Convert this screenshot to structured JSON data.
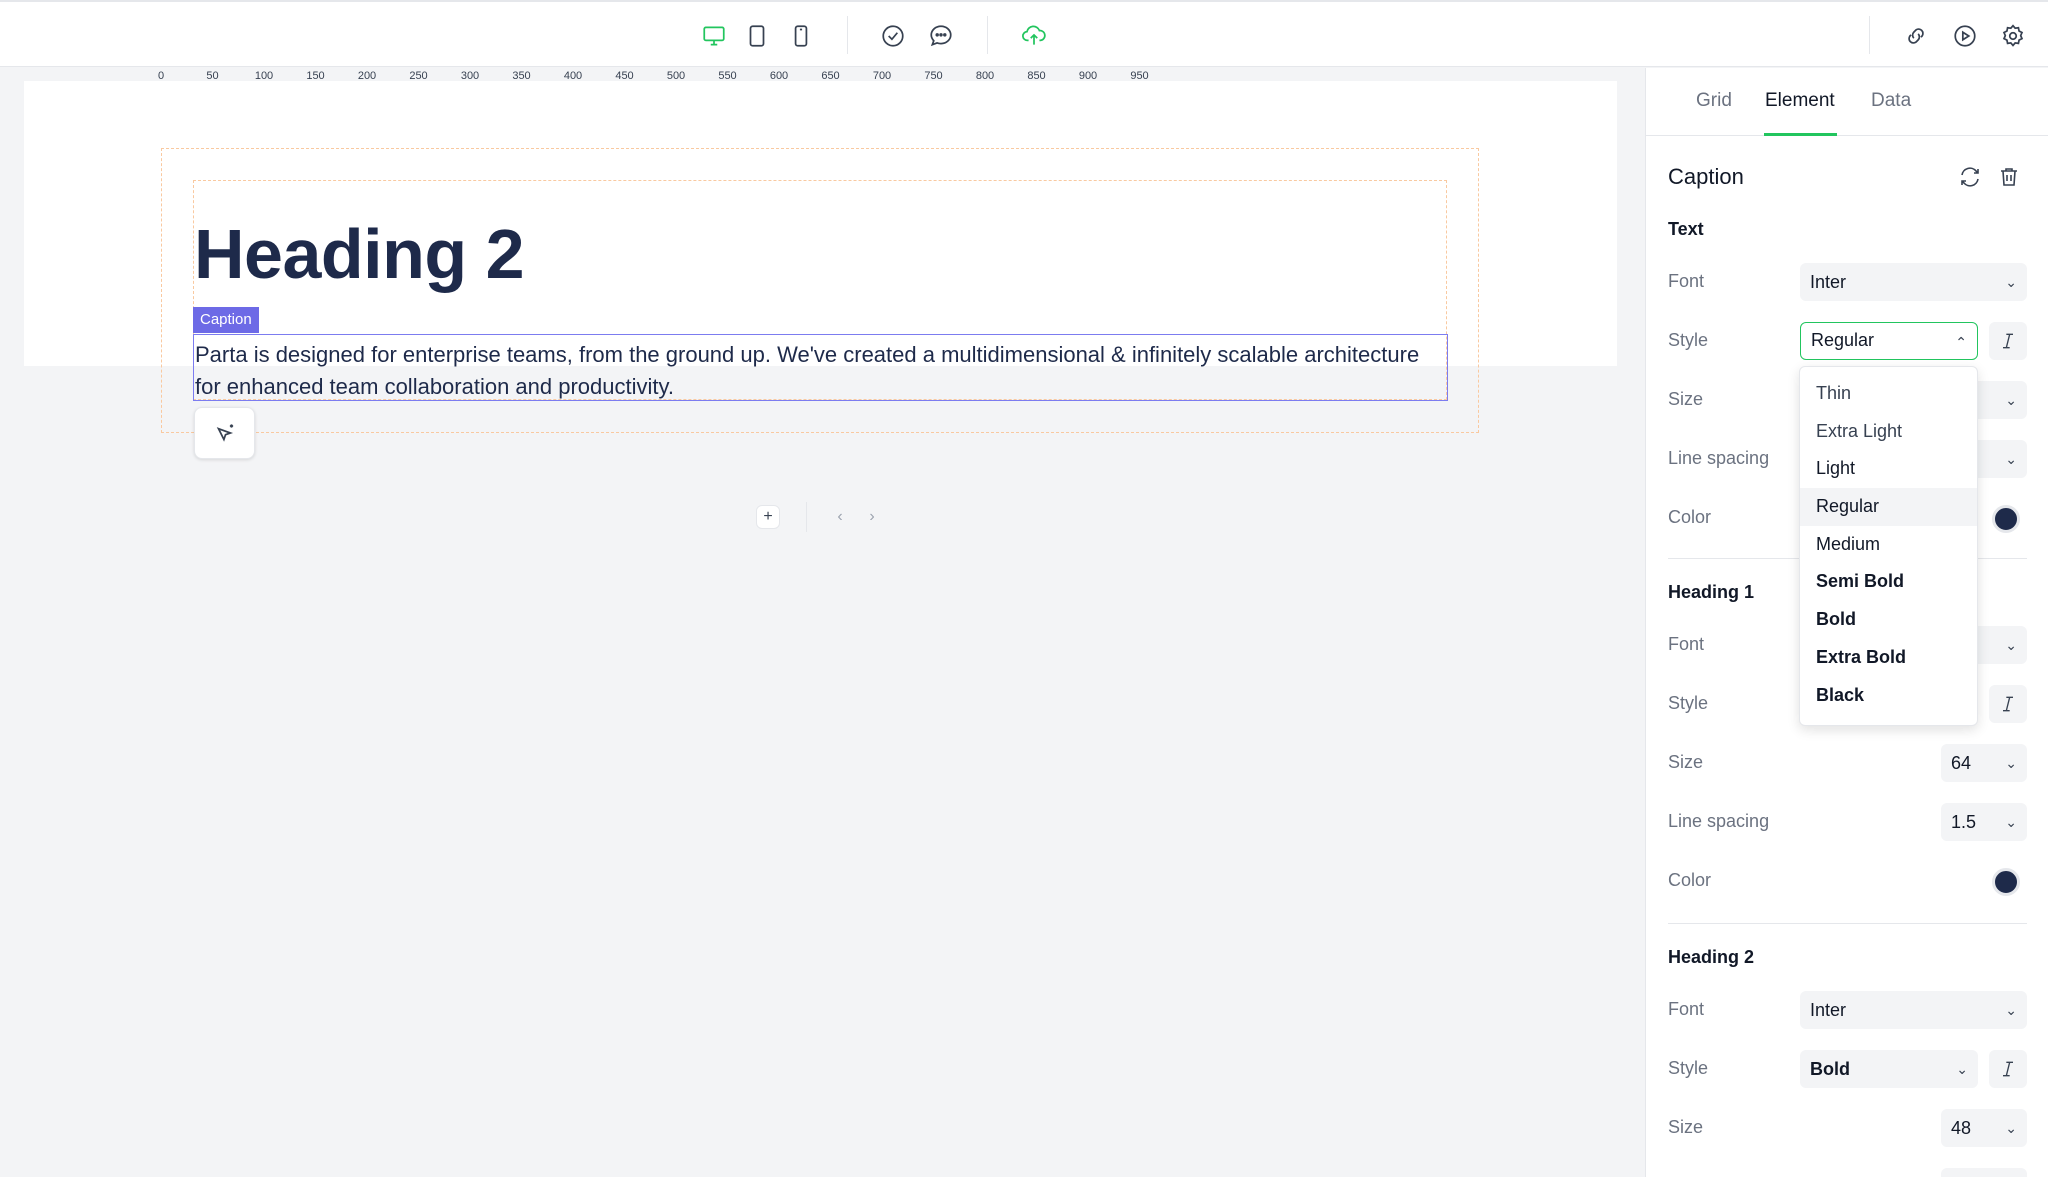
{
  "toolbar": {
    "device_icons": [
      "desktop-icon",
      "tablet-icon",
      "mobile-icon"
    ],
    "action_icons": [
      "check-circle-icon",
      "comment-icon"
    ],
    "publish_icon": "cloud-upload-icon",
    "right_icons": [
      "link-icon",
      "play-icon",
      "gear-icon"
    ],
    "accent": "#22c55e"
  },
  "ruler": {
    "labels": [
      "0",
      "50",
      "100",
      "150",
      "200",
      "250",
      "300",
      "350",
      "400",
      "450",
      "500",
      "550",
      "600",
      "650",
      "700",
      "750",
      "800",
      "850",
      "900",
      "950"
    ]
  },
  "canvas": {
    "heading": "Heading 2",
    "caption_tag": "Caption",
    "caption_text": "Parta is designed for enterprise teams, from the ground up. We've created a multidimensional & infinitely scalable architecture for enhanced team collaboration and productivity.",
    "add_label": "+",
    "prev_label": "‹",
    "next_label": "›"
  },
  "panel": {
    "tabs": [
      {
        "label": "Grid"
      },
      {
        "label": "Element"
      },
      {
        "label": "Data"
      }
    ],
    "active_tab": "Element",
    "title": "Caption",
    "sections": {
      "text": {
        "title": "Text",
        "font_label": "Font",
        "font_value": "Inter",
        "style_label": "Style",
        "style_value": "Regular",
        "size_label": "Size",
        "line_spacing_label": "Line spacing",
        "color_label": "Color"
      },
      "heading1": {
        "title": "Heading 1",
        "font_label": "Font",
        "style_label": "Style",
        "size_label": "Size",
        "size_value": "64",
        "line_spacing_label": "Line spacing",
        "line_spacing_value": "1.5",
        "color_label": "Color"
      },
      "heading2": {
        "title": "Heading 2",
        "font_label": "Font",
        "font_value": "Inter",
        "style_label": "Style",
        "style_value": "Bold",
        "size_label": "Size",
        "size_value": "48"
      }
    },
    "style_dropdown": {
      "options": [
        "Thin",
        "Extra Light",
        "Light",
        "Regular",
        "Medium",
        "Semi Bold",
        "Bold",
        "Extra Bold",
        "Black"
      ],
      "selected": "Regular"
    },
    "swatch_color": "#1e2a4a"
  }
}
